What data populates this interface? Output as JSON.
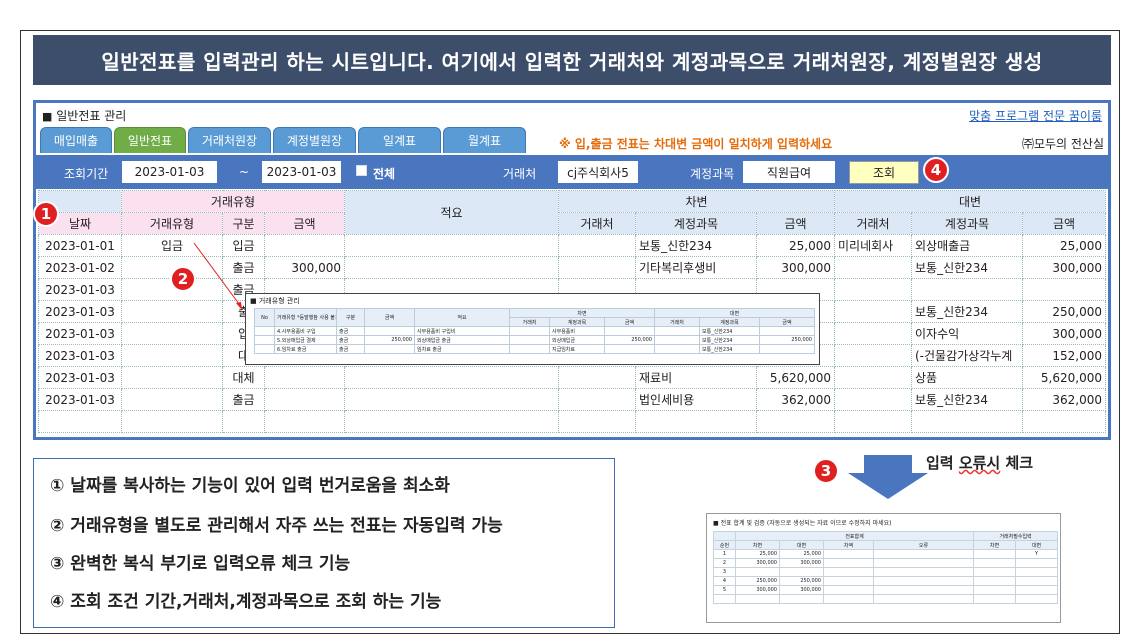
{
  "banner": "일반전표를 입력관리 하는 시트입니다. 여기에서 입력한 거래처와 계정과목으로 거래처원장, 계정별원장 생성",
  "sheet": {
    "title": "일반전표 관리",
    "toplink": "맞춤 프로그램 전문 꿈이룸",
    "tabs": [
      "매입매출",
      "일반전표",
      "거래처원장",
      "계정별원장",
      "일계표",
      "월계표"
    ],
    "active_tab": "일반전표",
    "notice": "※ 입,출금 전표는 차대변 금액이 일치하게 입력하세요",
    "company": "㈜모두의 전산실"
  },
  "filter": {
    "period_label": "조회기간",
    "from": "2023-01-03",
    "tilde": "~",
    "to": "2023-01-03",
    "all_label": "전체",
    "vendor_label": "거래처",
    "vendor_value": "cj주식회사5",
    "account_label": "계정과목",
    "account_value": "직원급여",
    "search_button": "조회"
  },
  "grid": {
    "group_headers": {
      "type": "거래유형",
      "memo": "적요",
      "debit": "차변",
      "credit": "대변"
    },
    "headers": {
      "date": "날짜",
      "type": "거래유형",
      "kind": "구분",
      "amount": "금액",
      "d_vendor": "거래처",
      "d_account": "계정과목",
      "d_amount": "금액",
      "c_vendor": "거래처",
      "c_account": "계정과목",
      "c_amount": "금액"
    },
    "rows": [
      [
        "2023-01-01",
        "입금",
        "입금",
        "",
        "",
        "",
        "보통_신한234",
        "25,000",
        "미리네회사",
        "외상매출금",
        "25,000"
      ],
      [
        "2023-01-02",
        "",
        "출금",
        "300,000",
        "",
        "",
        "기타복리후생비",
        "300,000",
        "",
        "보통_신한234",
        "300,000"
      ],
      [
        "2023-01-03",
        "",
        "출금",
        "",
        "",
        "",
        "",
        "",
        "",
        "",
        ""
      ],
      [
        "2023-01-03",
        "",
        "출",
        "",
        "",
        "",
        "",
        "",
        "",
        "보통_신한234",
        "250,000"
      ],
      [
        "2023-01-03",
        "",
        "입",
        "",
        "",
        "",
        "",
        "",
        "",
        "이자수익",
        "300,000"
      ],
      [
        "2023-01-03",
        "",
        "대",
        "",
        "",
        "",
        "",
        "",
        "",
        "(-건물감가상각누계",
        "152,000"
      ],
      [
        "2023-01-03",
        "",
        "대체",
        "",
        "",
        "",
        "재료비",
        "5,620,000",
        "",
        "상품",
        "5,620,000"
      ],
      [
        "2023-01-03",
        "",
        "출금",
        "",
        "",
        "",
        "법인세비용",
        "362,000",
        "",
        "보통_신한234",
        "362,000"
      ],
      [
        "",
        "",
        "",
        "",
        "",
        "",
        "",
        "",
        "",
        "",
        ""
      ]
    ],
    "debit_amount_overflow": [
      "0",
      "0",
      "0"
    ]
  },
  "popup": {
    "title": "거래유형 관리",
    "headers": [
      "No",
      "거래유형\n*등발행참 사용 불가",
      "구분",
      "금액",
      "적요",
      "거래처",
      "계정과목",
      "금액",
      "거래처",
      "계정과목",
      "금액"
    ],
    "group_debit": "차변",
    "group_credit": "대변",
    "rows": [
      [
        "",
        "4.사무용품비 구입",
        "출금",
        "",
        "사무용품비 구입비",
        "",
        "사무용품비",
        "",
        "",
        "보통_신한234",
        ""
      ],
      [
        "",
        "5.외상매입금 결제",
        "출금",
        "250,000",
        "외상매입금 출금",
        "",
        "외상매입금",
        "250,000",
        "",
        "보통_신한234",
        "250,000"
      ],
      [
        "",
        "6.임차료 출금",
        "출금",
        "",
        "임차료 출금",
        "",
        "지급임차료",
        "",
        "",
        "보통_신한234",
        ""
      ]
    ]
  },
  "markers": [
    "1",
    "2",
    "3",
    "4"
  ],
  "notes": [
    "① 날짜를 복사하는 기능이 있어 입력 번거로움을 최소화",
    "② 거래유형을 별도로 관리해서 자주 쓰는 전표는 자동입력 가능",
    "③ 완벽한 복식 부기로 입력오류 체크 기능",
    "④ 조회 조건 기간,거래처,계정과목으로 조회 하는 기능"
  ],
  "check": {
    "prefix": "입력 ",
    "squiggle": "오류시",
    "suffix": " 체크"
  },
  "errbox": {
    "title": "전표 합계 및 검증 (자동으로 생성되는 자료 이므로 수정하지 마세요)",
    "group_total": "전표합계",
    "group_vendor": "거래처필수입력",
    "headers": [
      "순번",
      "차변",
      "대변",
      "차액",
      "오류",
      "차변",
      "대변"
    ],
    "rows": [
      [
        "1",
        "25,000",
        "25,000",
        "",
        "",
        "",
        "Y"
      ],
      [
        "2",
        "300,000",
        "300,000",
        "",
        "",
        "",
        ""
      ],
      [
        "3",
        "",
        "",
        "",
        "",
        "",
        ""
      ],
      [
        "4",
        "250,000",
        "250,000",
        "",
        "",
        "",
        ""
      ],
      [
        "5",
        "300,000",
        "300,000",
        "",
        "",
        "",
        ""
      ],
      [
        "",
        "",
        "",
        "",
        "",
        "",
        ""
      ]
    ]
  },
  "colors": {
    "banner": "#3d4e6b",
    "accent": "#4a76c0",
    "tab": "#5a9bd5",
    "tab_active": "#70ad47",
    "marker": "#e02020",
    "notice": "#e46c0a"
  }
}
